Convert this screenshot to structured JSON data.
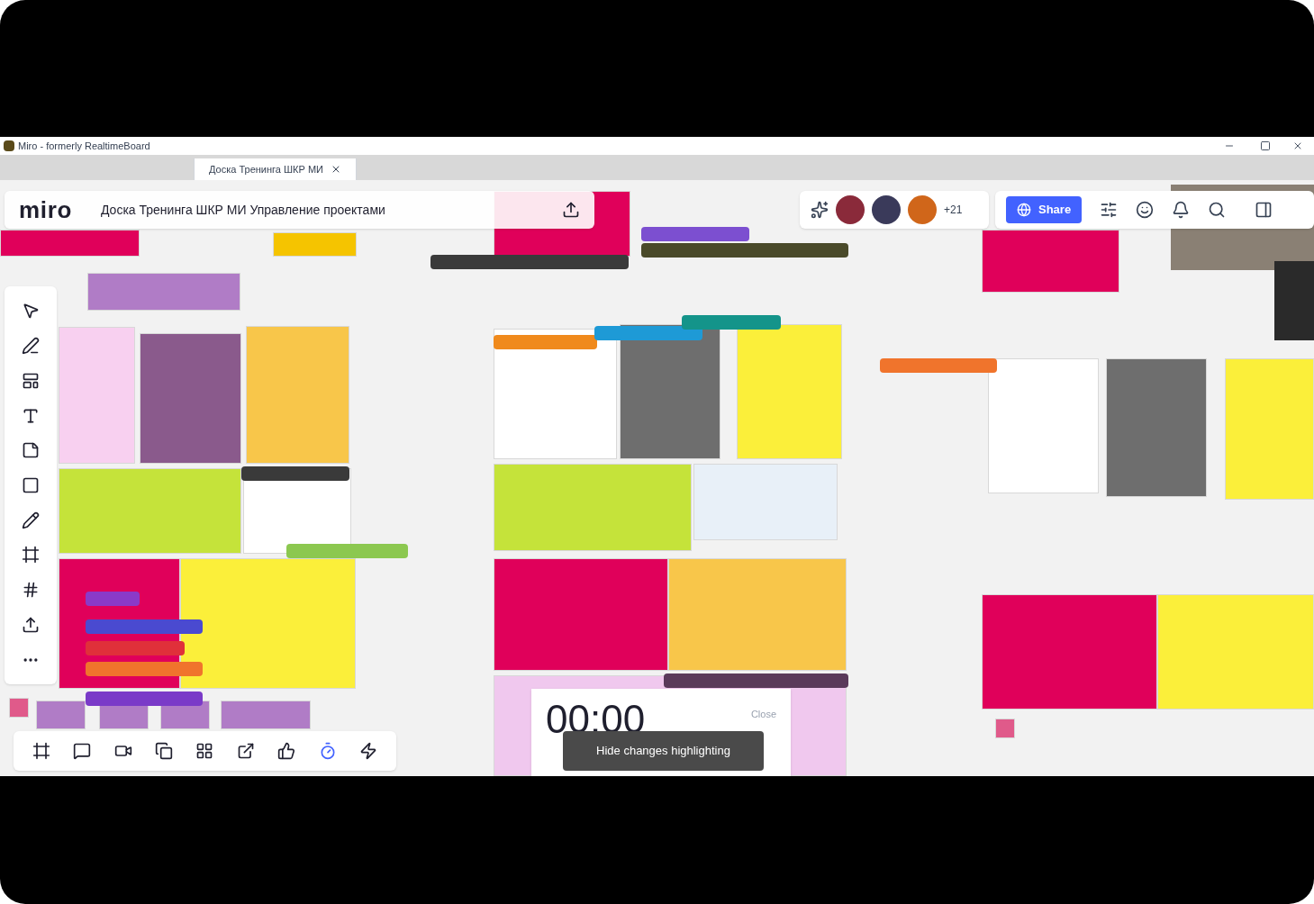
{
  "window": {
    "title": "Miro - formerly RealtimeBoard"
  },
  "tabs": [
    {
      "label": "Доска Тренинга ШКР МИ",
      "selected": true
    }
  ],
  "board": {
    "logo": "miro",
    "title": "Доска Тренинга ШКР МИ Управление проектами"
  },
  "collaborators": {
    "extra_count": "+21"
  },
  "share_button": "Share",
  "timer": {
    "time": "00:00",
    "close": "Close"
  },
  "tooltip": "Hide changes highlighting"
}
